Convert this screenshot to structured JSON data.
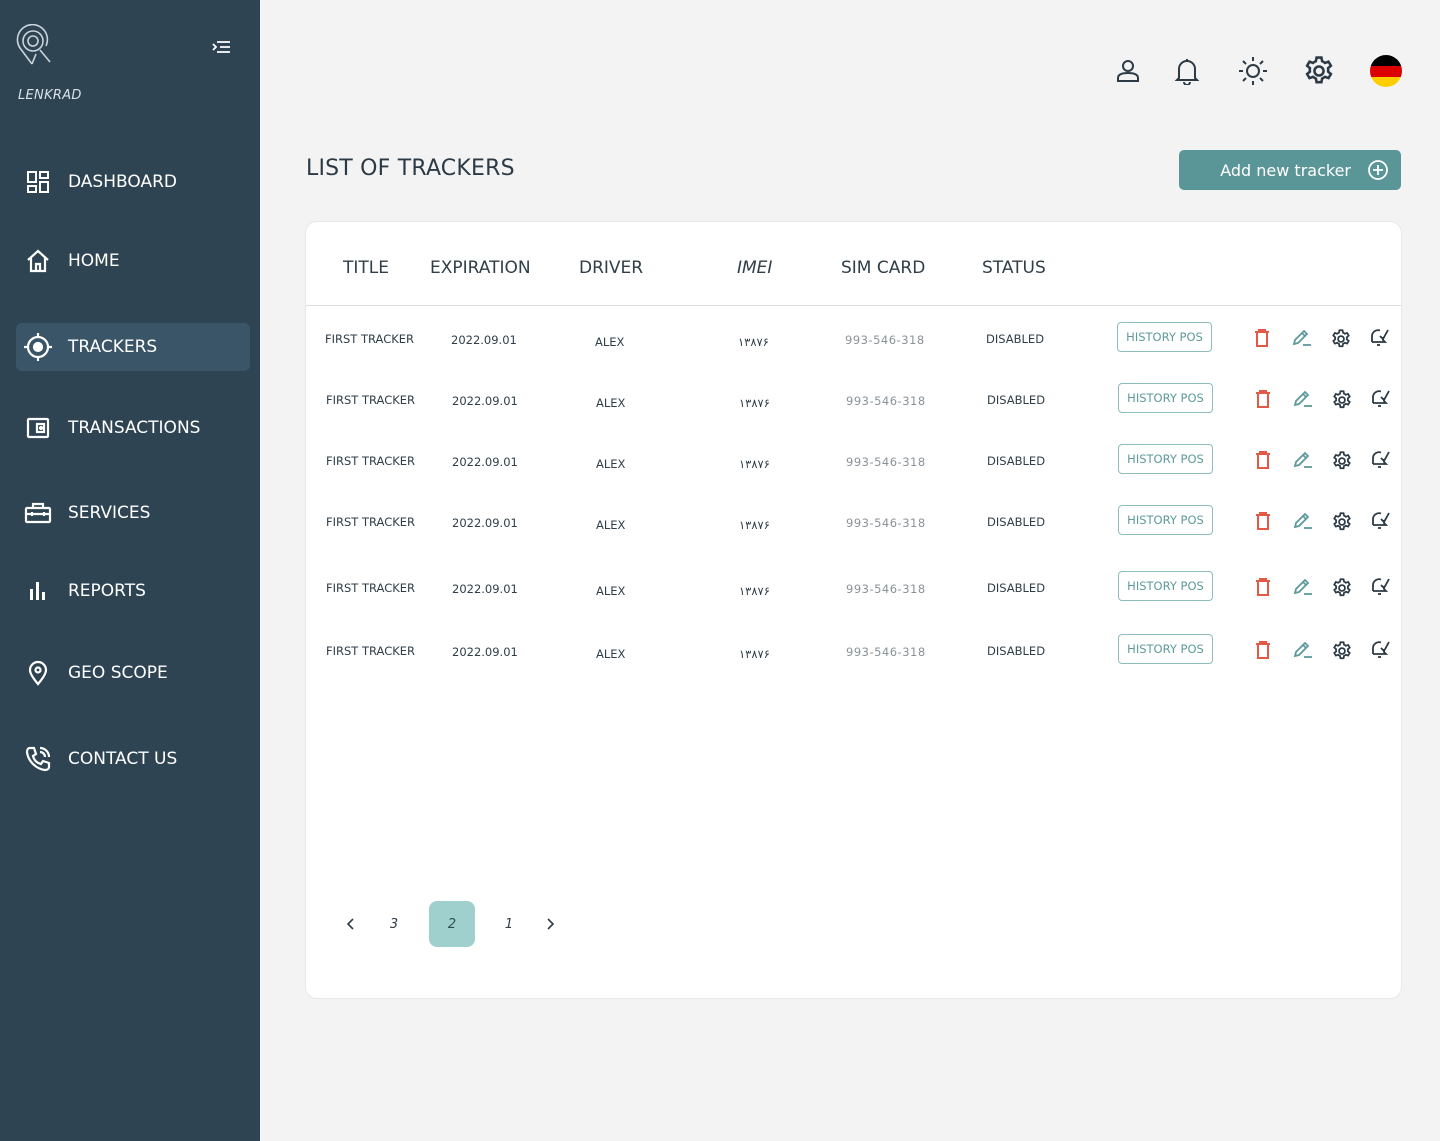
{
  "app": {
    "brand": "LENKRAD"
  },
  "sidebar": {
    "items": [
      {
        "label": "DASHBOARD",
        "icon": "dashboard-icon"
      },
      {
        "label": "HOME",
        "icon": "home-icon"
      },
      {
        "label": "TRACKERS",
        "icon": "target-icon",
        "active": true
      },
      {
        "label": "TRANSACTIONS",
        "icon": "wallet-icon"
      },
      {
        "label": "SERVICES",
        "icon": "toolbox-icon"
      },
      {
        "label": "REPORTS",
        "icon": "bar-chart-icon"
      },
      {
        "label": "GEO SCOPE",
        "icon": "location-pin-icon"
      },
      {
        "label": "CONTACT US",
        "icon": "phone-icon"
      }
    ]
  },
  "header": {
    "icons": [
      "user-icon",
      "bell-icon",
      "sun-icon",
      "settings-gear-icon",
      "germany-flag-icon"
    ]
  },
  "main": {
    "title": "LIST OF TRACKERS",
    "add_button_label": "Add new tracker",
    "columns": [
      "TITLE",
      "EXPIRATION",
      "DRIVER",
      "IMEI",
      "SIM CARD",
      "STATUS"
    ],
    "rows": [
      {
        "title": "FIRST TRACKER",
        "expiration": "2022.09.01",
        "driver": "ALEX",
        "imei": "۱۳۸۷۶",
        "sim": "993-546-318",
        "status": "DISABLED",
        "action": "HISTORY POS"
      },
      {
        "title": "FIRST TRACKER",
        "expiration": "2022.09.01",
        "driver": "ALEX",
        "imei": "۱۳۸۷۶",
        "sim": "993-546-318",
        "status": "DISABLED",
        "action": "HISTORY POS"
      },
      {
        "title": "FIRST TRACKER",
        "expiration": "2022.09.01",
        "driver": "ALEX",
        "imei": "۱۳۸۷۶",
        "sim": "993-546-318",
        "status": "DISABLED",
        "action": "HISTORY POS"
      },
      {
        "title": "FIRST TRACKER",
        "expiration": "2022.09.01",
        "driver": "ALEX",
        "imei": "۱۳۸۷۶",
        "sim": "993-546-318",
        "status": "DISABLED",
        "action": "HISTORY POS"
      },
      {
        "title": "FIRST TRACKER",
        "expiration": "2022.09.01",
        "driver": "ALEX",
        "imei": "۱۳۸۷۶",
        "sim": "993-546-318",
        "status": "DISABLED",
        "action": "HISTORY POS"
      },
      {
        "title": "FIRST TRACKER",
        "expiration": "2022.09.01",
        "driver": "ALEX",
        "imei": "۱۳۸۷۶",
        "sim": "993-546-318",
        "status": "DISABLED",
        "action": "HISTORY POS"
      }
    ],
    "pagination": {
      "pages": [
        "3",
        "2",
        "1"
      ],
      "current": "2"
    }
  },
  "colors": {
    "sidebar_bg": "#2e4453",
    "accent": "#5a9598",
    "delete": "#e25a45",
    "edit": "#5e9a9c"
  }
}
